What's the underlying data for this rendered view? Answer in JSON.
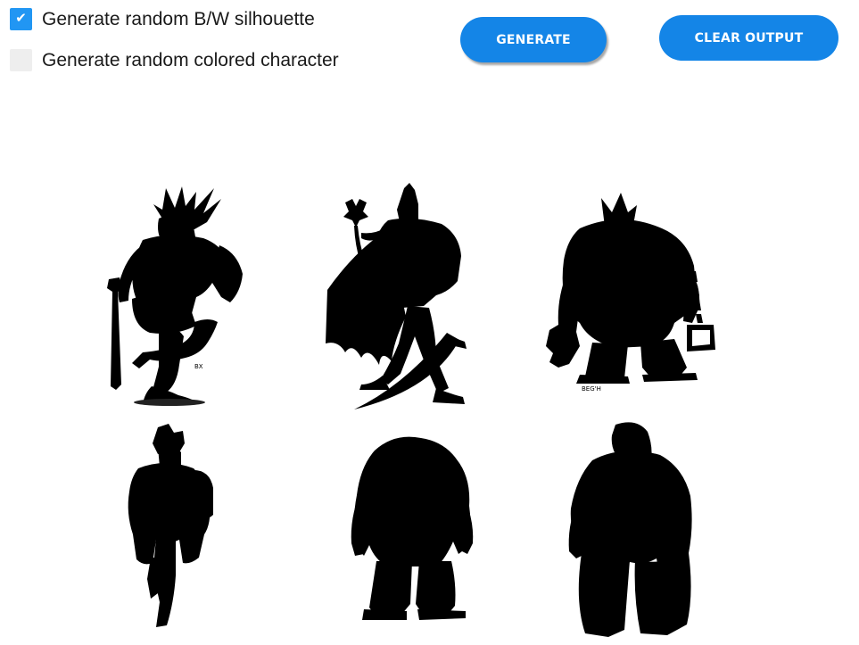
{
  "options": [
    {
      "label": "Generate random B/W silhouette",
      "checked": true,
      "check_glyph": "✔"
    },
    {
      "label": "Generate random colored character",
      "checked": false
    }
  ],
  "buttons": {
    "generate_label": "GENERATE",
    "clear_label": "CLEAR OUTPUT",
    "accent_color": "#1485e7"
  },
  "output": {
    "silhouettes": [
      {
        "name": "silhouette-reptile-warrior-with-sword"
      },
      {
        "name": "silhouette-caped-knight-with-staff-and-scythe"
      },
      {
        "name": "silhouette-armored-brute-with-chain"
      },
      {
        "name": "silhouette-armored-female-warrior"
      },
      {
        "name": "silhouette-hairy-beast"
      },
      {
        "name": "silhouette-hulking-hooded-giant"
      }
    ],
    "signature_marks": [
      "BX",
      "BEG'H"
    ]
  }
}
